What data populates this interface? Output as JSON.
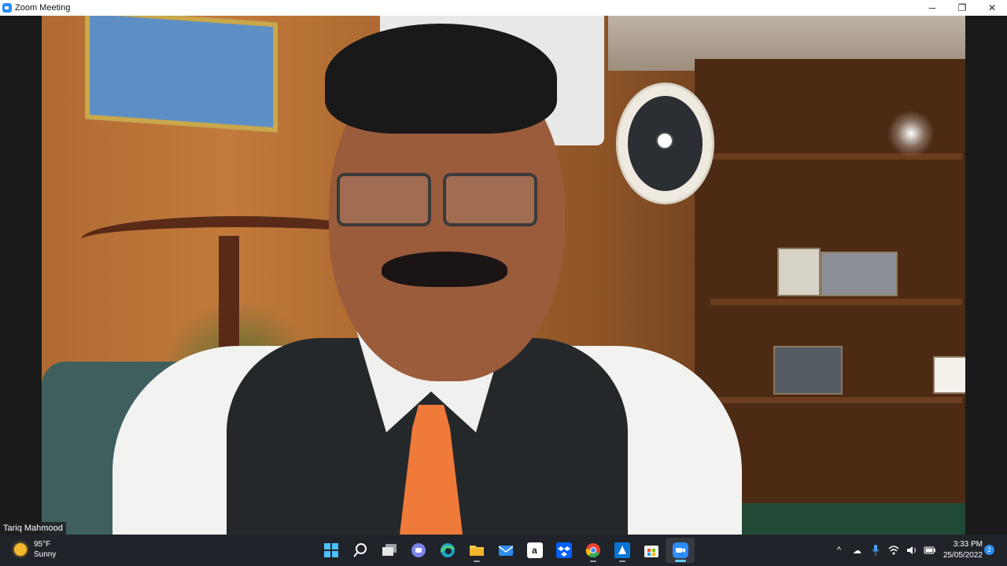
{
  "window": {
    "title": "Zoom Meeting",
    "controls": {
      "minimize": "─",
      "restore": "❐",
      "close": "✕"
    }
  },
  "video": {
    "participant_name": "Tariq Mahmood"
  },
  "taskbar": {
    "weather": {
      "temperature": "95°F",
      "condition": "Sunny",
      "icon": "sun-icon"
    },
    "apps": [
      {
        "name": "start",
        "icon": "windows-logo-icon",
        "glyph": "",
        "color": "#4cc2ff"
      },
      {
        "name": "search",
        "icon": "search-icon",
        "glyph": "",
        "color": "#ffffff"
      },
      {
        "name": "task-view",
        "icon": "task-view-icon",
        "glyph": "",
        "color": "#cfd3d8"
      },
      {
        "name": "chat",
        "icon": "teams-chat-icon",
        "glyph": "",
        "color": "#7b83eb"
      },
      {
        "name": "edge",
        "icon": "edge-icon",
        "glyph": "",
        "color": "#1fa3c4"
      },
      {
        "name": "file-explorer",
        "icon": "folder-icon",
        "glyph": "",
        "color": "#f7c948"
      },
      {
        "name": "mail",
        "icon": "mail-icon",
        "glyph": "",
        "color": "#2f8cf0"
      },
      {
        "name": "amazon",
        "icon": "amazon-icon",
        "glyph": "a",
        "color": "#ffffff"
      },
      {
        "name": "dropbox",
        "icon": "dropbox-icon",
        "glyph": "",
        "color": "#0061fe"
      },
      {
        "name": "chrome",
        "icon": "chrome-icon",
        "glyph": "",
        "color": "#ea4335"
      },
      {
        "name": "azure",
        "icon": "azure-icon",
        "glyph": "",
        "color": "#0a75d8"
      },
      {
        "name": "store",
        "icon": "store-icon",
        "glyph": "",
        "color": "#f2f2f2"
      },
      {
        "name": "zoom",
        "icon": "zoom-icon",
        "glyph": "",
        "color": "#2d8cff"
      }
    ],
    "tray": {
      "chevron": "^",
      "cloud": "☁",
      "mic": "🎤",
      "wifi": "wifi-icon",
      "volume": "🔊",
      "battery": "battery-icon"
    },
    "clock": {
      "time": "3:33 PM",
      "date": "25/05/2022"
    },
    "notifications": "2"
  }
}
